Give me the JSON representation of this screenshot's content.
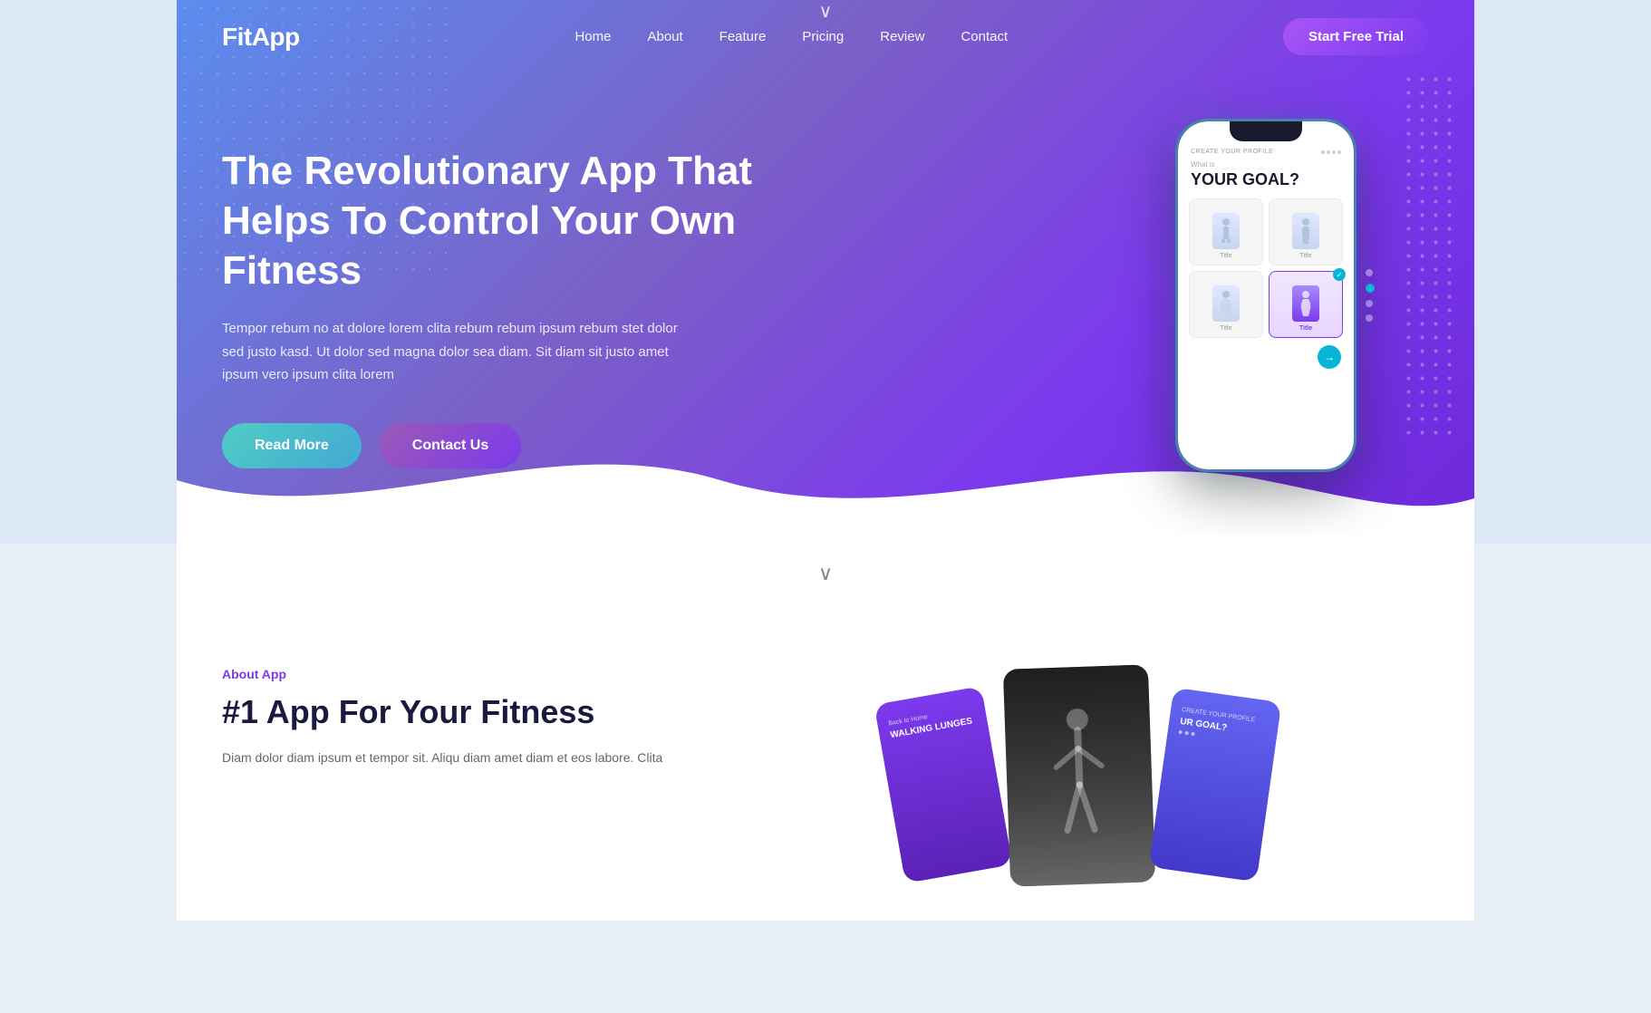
{
  "brand": {
    "logo": "FitApp"
  },
  "navbar": {
    "links": [
      {
        "label": "Home",
        "id": "home"
      },
      {
        "label": "About",
        "id": "about"
      },
      {
        "label": "Feature",
        "id": "feature"
      },
      {
        "label": "Pricing",
        "id": "pricing"
      },
      {
        "label": "Review",
        "id": "review"
      },
      {
        "label": "Contact",
        "id": "contact"
      }
    ],
    "cta_label": "Start Free Trial"
  },
  "hero": {
    "title": "The Revolutionary App That Helps To Control Your Own Fitness",
    "subtitle": "Tempor rebum no at dolore lorem clita rebum rebum ipsum rebum stet dolor sed justo kasd. Ut dolor sed magna dolor sea diam. Sit diam sit justo amet ipsum vero ipsum clita lorem",
    "btn_read_more": "Read More",
    "btn_contact": "Contact Us"
  },
  "phone_mockup": {
    "header_label": "CREATE YOUR PROFILE",
    "goal_intro": "What is",
    "goal_title": "YOUR GOAL?",
    "cards": [
      {
        "label": "Title",
        "selected": false
      },
      {
        "label": "Title",
        "selected": false
      },
      {
        "label": "Title",
        "selected": false
      },
      {
        "label": "Title",
        "selected": true
      }
    ]
  },
  "scroll_chevron": "∨",
  "about": {
    "label": "About App",
    "title": "#1 App For Your Fitness",
    "description": "Diam dolor diam ipsum et tempor sit. Aliqu diam amet diam et eos labore. Clita"
  },
  "about_cards": [
    {
      "top_label": "Back to Home",
      "title": "WALKING LUNGES"
    },
    {
      "top_label": "",
      "title": ""
    },
    {
      "top_label": "CREATE YOUR PROFILE",
      "title": "UR GOAL?"
    }
  ],
  "colors": {
    "accent": "#7c3aed",
    "teal": "#06b6d4",
    "gradient_start": "#5b8dee",
    "gradient_end": "#6d28d9"
  }
}
